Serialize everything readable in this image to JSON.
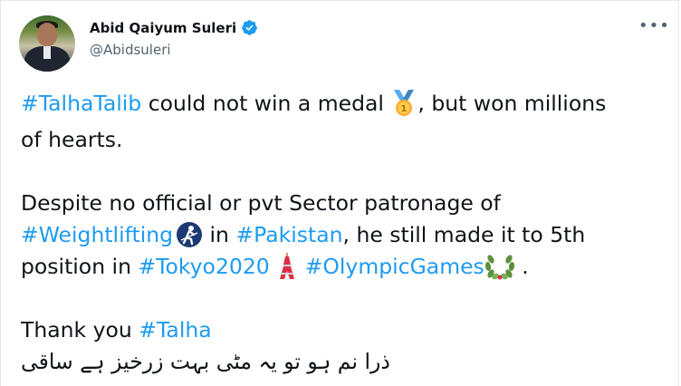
{
  "author": {
    "name": "Abid Qaiyum Suleri",
    "handle": "@Abidsuleri",
    "verified": true
  },
  "more_icon": "more-options-icon",
  "tweet": {
    "line1": {
      "hashtag": "#TalhaTalib",
      "text_a": " could not win a medal ",
      "text_b": ", but won millions"
    },
    "line2": {
      "text": "of hearts."
    },
    "line3": {
      "text": "Despite no official or pvt Sector patronage of"
    },
    "line4": {
      "hashtag_a": "#Weightlifting",
      "text_a": " in ",
      "hashtag_b": "#Pakistan",
      "text_b": ", he still made it to 5th"
    },
    "line5": {
      "text_a": "position in ",
      "hashtag_a": "#Tokyo2020",
      "hashtag_b": "#OlympicGames",
      "text_b": " ."
    },
    "line6": {
      "text_a": "Thank you ",
      "hashtag_a": "#Talha"
    },
    "line7": {
      "text": "ذرا نم ہو تو یہ مٹی بہت زرخیز ہے ساقی"
    }
  },
  "icons": [
    "first-place-medal-icon",
    "weightlifter-icon",
    "tokyo-tower-icon",
    "olympic-wreath-icon"
  ],
  "colors": {
    "hashtag": "#1d9bf0",
    "text": "#0f1419",
    "secondary": "#536471",
    "verified": "#1d9bf0"
  }
}
